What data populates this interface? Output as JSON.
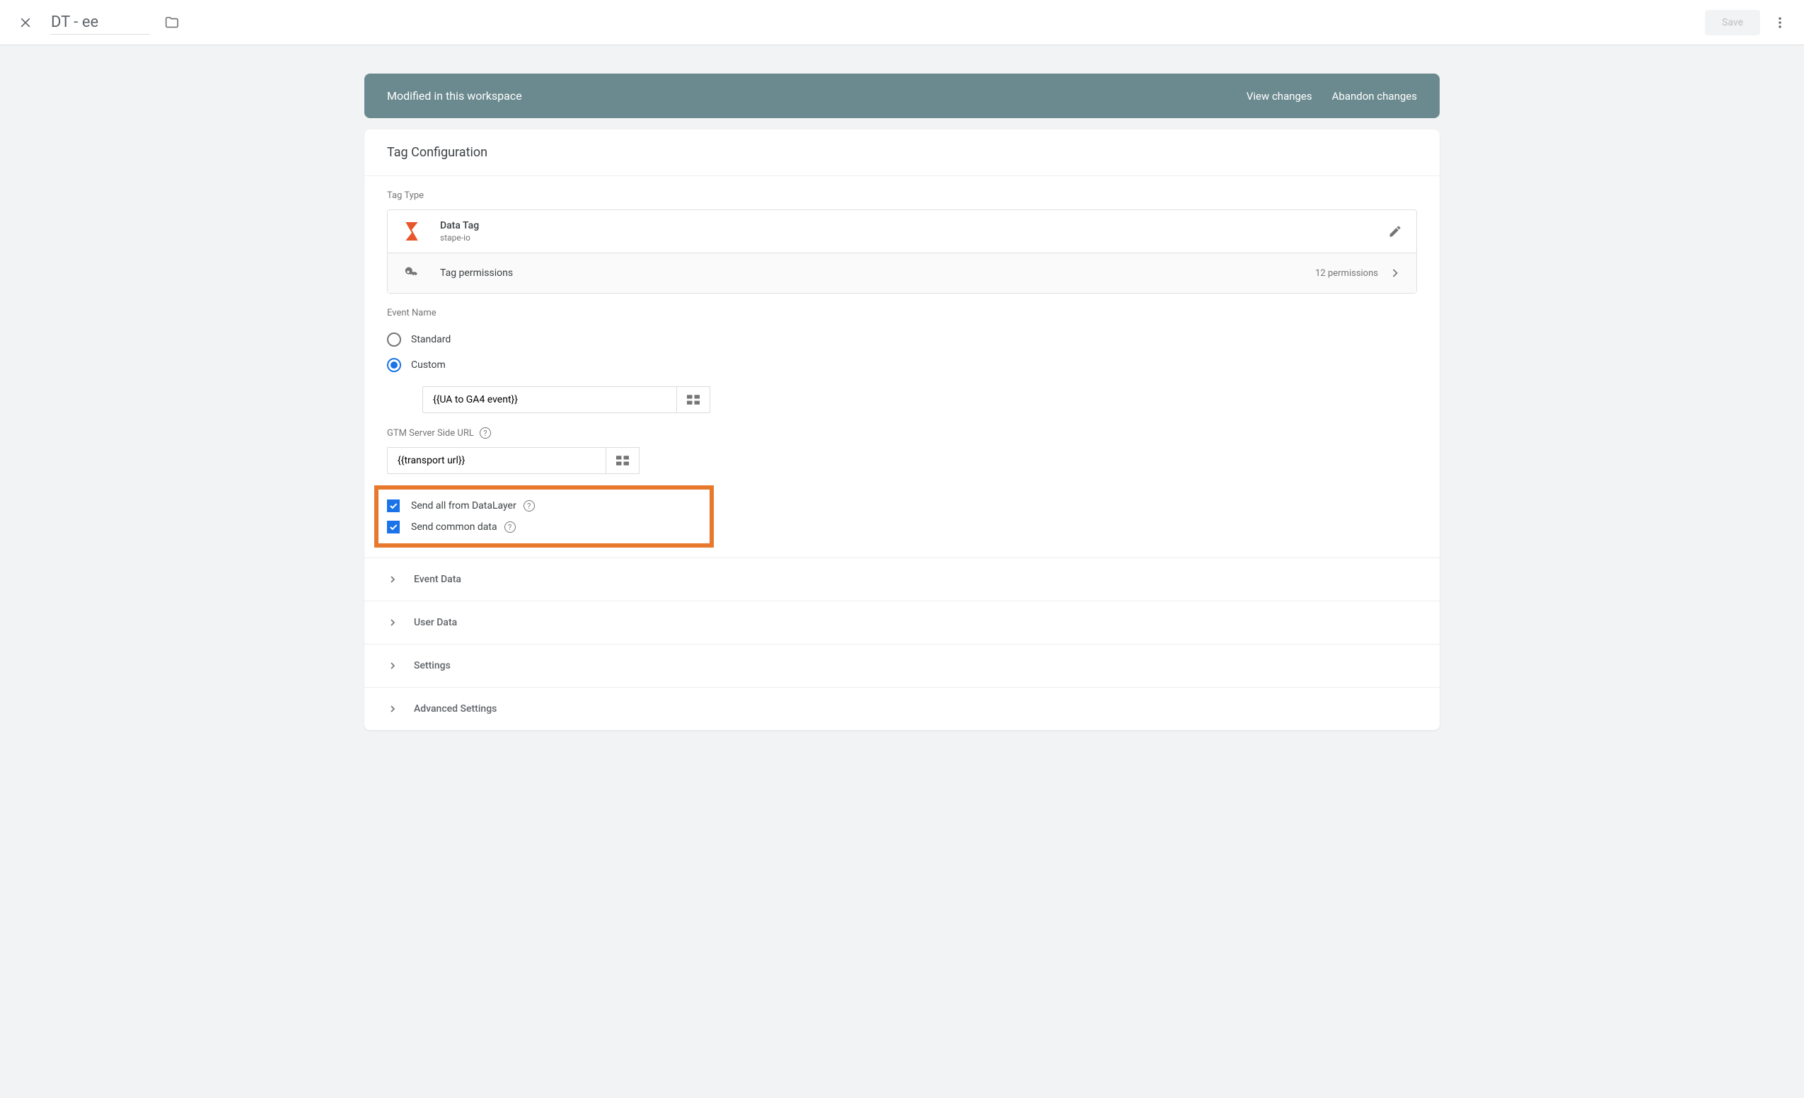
{
  "header": {
    "title": "DT - ee",
    "save_label": "Save"
  },
  "banner": {
    "message": "Modified in this workspace",
    "view_changes": "View changes",
    "abandon_changes": "Abandon changes"
  },
  "card": {
    "title": "Tag Configuration",
    "tag_type_label": "Tag Type",
    "tag": {
      "name": "Data Tag",
      "publisher": "stape-io",
      "permissions_label": "Tag permissions",
      "permissions_count": "12 permissions"
    },
    "event_name_label": "Event Name",
    "event_name": {
      "standard": "Standard",
      "custom": "Custom",
      "custom_value": "{{UA to GA4 event}}"
    },
    "server_url_label": "GTM Server Side URL",
    "server_url_value": "{{transport url}}",
    "checkboxes": {
      "send_all_datalayer": "Send all from DataLayer",
      "send_common_data": "Send common data"
    },
    "expand": {
      "event_data": "Event Data",
      "user_data": "User Data",
      "settings": "Settings",
      "advanced_settings": "Advanced Settings"
    }
  }
}
